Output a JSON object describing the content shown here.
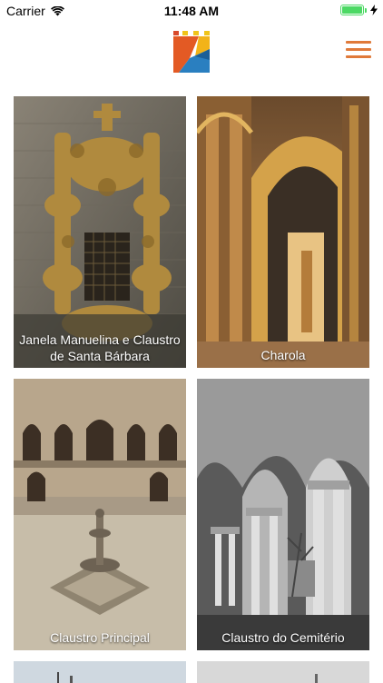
{
  "status_bar": {
    "carrier": "Carrier",
    "time": "11:48 AM",
    "battery_level": 1.0,
    "icons": [
      "wifi-icon",
      "charging-bolt-icon",
      "battery-icon"
    ]
  },
  "header": {
    "logo": "app-logo",
    "menu_icon": "hamburger-menu-icon",
    "accent_color": "#e07a3a"
  },
  "cards": [
    {
      "label": "Janela Manuelina e Claustro de Santa Bárbara"
    },
    {
      "label": "Charola"
    },
    {
      "label": "Claustro Principal"
    },
    {
      "label": "Claustro do Cemitério"
    }
  ]
}
